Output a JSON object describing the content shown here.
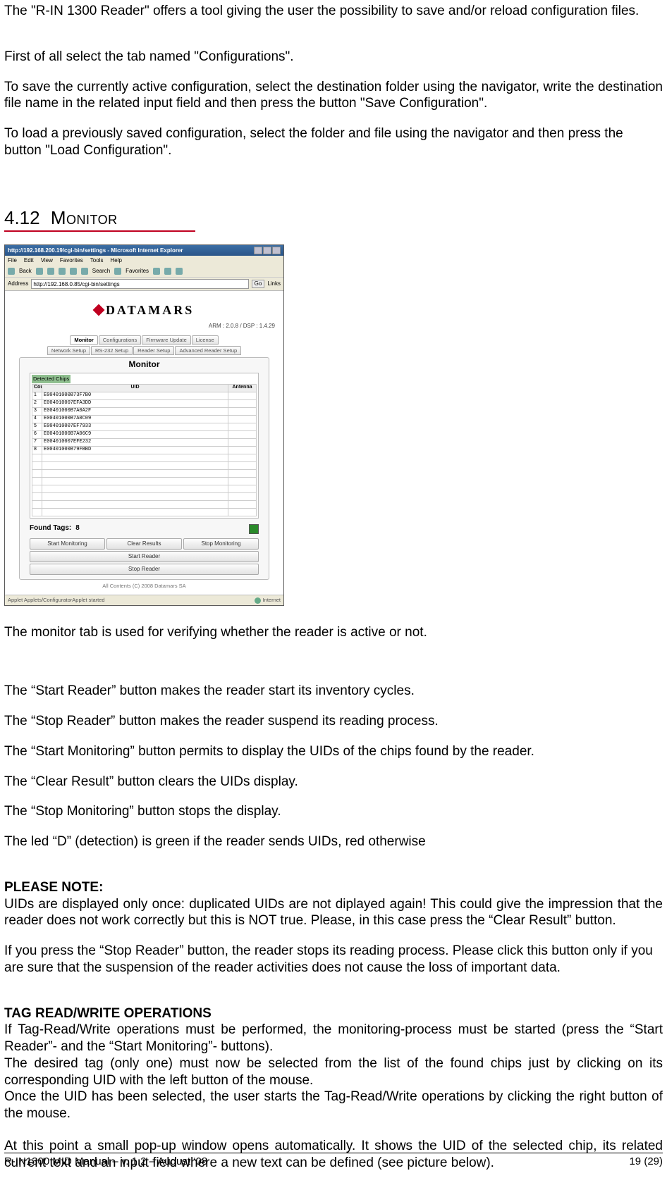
{
  "intro": {
    "p1": "The \"R-IN 1300 Reader\" offers a tool giving the user the possibility to save and/or reload configuration files.",
    "p2": "First of all select the tab named \"Configurations\".",
    "p3": "To save the currently active configuration, select the destination folder using the navigator, write the destination file name in the related input field and then press the button \"Save Configuration\".",
    "p4": "To load a previously saved configuration, select the folder and file using the navigator and then press the button \"Load Configuration\"."
  },
  "section": {
    "number": "4.12",
    "title": "Monitor"
  },
  "screenshot": {
    "window_title": "http://192.168.200.19/cgi-bin/settings - Microsoft Internet Explorer",
    "menus": [
      "File",
      "Edit",
      "View",
      "Favorites",
      "Tools",
      "Help"
    ],
    "toolbar": {
      "back": "Back",
      "search": "Search",
      "favorites": "Favorites"
    },
    "address_label": "Address",
    "address_value": "http://192.168.0.85/cgi-bin/settings",
    "go": "Go",
    "links": "Links",
    "logo_text": "DATAMARS",
    "arm_line": "ARM : 2.0.8 / DSP : 1.4.29",
    "tabs_top": [
      {
        "label": "Monitor",
        "active": true
      },
      {
        "label": "Configurations"
      },
      {
        "label": "Firmware Update"
      },
      {
        "label": "License"
      }
    ],
    "tabs_bottom": [
      {
        "label": "Network Setup"
      },
      {
        "label": "RS-232 Setup"
      },
      {
        "label": "Reader Setup"
      },
      {
        "label": "Advanced Reader Setup"
      }
    ],
    "panel_title": "Monitor",
    "detected_label": "Detected Chips",
    "columns": {
      "count": "Count",
      "uid": "UID",
      "antenna": "Antenna"
    },
    "chips": [
      {
        "n": "1",
        "uid": "E00401000B73F7B0"
      },
      {
        "n": "2",
        "uid": "E004010007EFA3DD"
      },
      {
        "n": "3",
        "uid": "E00401000B7A0A2F"
      },
      {
        "n": "4",
        "uid": "E00401000B7A0C09"
      },
      {
        "n": "5",
        "uid": "E004010007EF7933"
      },
      {
        "n": "6",
        "uid": "E00401000B7A06C9"
      },
      {
        "n": "7",
        "uid": "E004010007EFE232"
      },
      {
        "n": "8",
        "uid": "E00401000B79FBBD"
      }
    ],
    "blank_rows": 8,
    "found_label": "Found Tags:",
    "found_value": "8",
    "btns3": [
      "Start Monitoring",
      "Clear Results",
      "Stop Monitoring"
    ],
    "btn_start_reader": "Start Reader",
    "btn_stop_reader": "Stop Reader",
    "copyright": "All Contents (C) 2008 Datamars SA",
    "status_left": "Applet Applets/ConfiguratorApplet started",
    "status_right": "Internet"
  },
  "desc": {
    "d0": "The monitor tab is used for verifying whether the reader is active or not.",
    "d1": "The “Start Reader” button makes the reader start its inventory cycles.",
    "d2": "The “Stop Reader” button makes the reader suspend its reading process.",
    "d3": "The “Start Monitoring” button permits to display the UIDs of the chips found by the reader.",
    "d4": "The “Clear Result” button clears the UIDs display.",
    "d5": "The “Stop Monitoring” button stops the display.",
    "d6": "The led “D” (detection) is green if the reader sends UIDs, red otherwise"
  },
  "note": {
    "heading": "PLEASE NOTE:",
    "n1": "UIDs are displayed only once:  duplicated UIDs are not diplayed again!  This could give the impression that the reader does not work correctly but this is NOT true.  Please, in this case press the “Clear Result” button.",
    "n2": "If you press the “Stop Reader” button, the reader stops its reading process.  Please click this button only if you are sure that the suspension of the reader activities does not cause the loss of important data."
  },
  "tagops": {
    "heading": "TAG READ/WRITE OPERATIONS",
    "t1": "If Tag-Read/Write operations must be performed, the monitoring-process must be started (press the “Start Reader”- and the “Start Monitoring”- buttons).",
    "t2": "The desired tag (only one) must now be selected from the list of the found chips just by clicking on its corresponding UID with the left button of the mouse.",
    "t3": "Once the UID has been selected, the user starts the Tag-Read/Write operations by clicking the right button of the mouse.",
    "t4": "At this point a small pop-up window opens automatically. It shows the UID of the selected chip, its related current text and an input field where a new text can be defined (see picture below)."
  },
  "footer": {
    "left": "R-IN1300 MID Manual  – v. 1.2 – August ‘08",
    "right": "19 (29)"
  }
}
